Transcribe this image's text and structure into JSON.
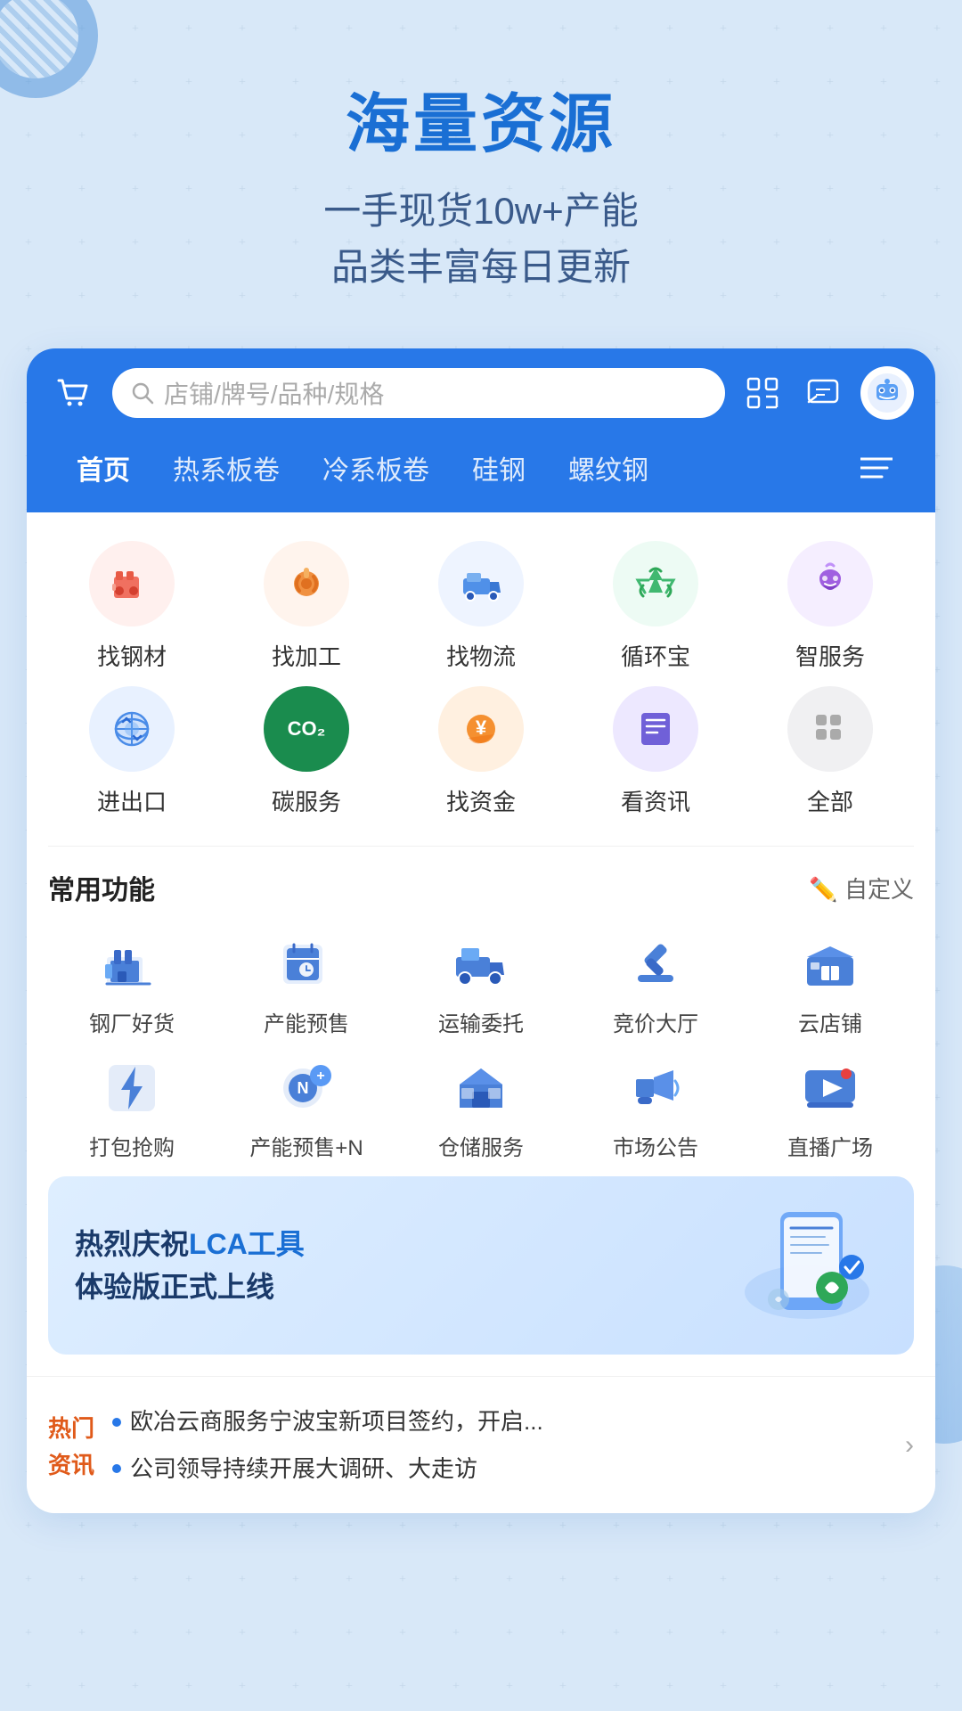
{
  "hero": {
    "title": "海量资源",
    "subtitle_line1": "一手现货10w+产能",
    "subtitle_line2": "品类丰富每日更新"
  },
  "header": {
    "search_placeholder": "店铺/牌号/品种/规格",
    "nav_tabs": [
      {
        "label": "首页",
        "active": true
      },
      {
        "label": "热系板卷",
        "active": false
      },
      {
        "label": "冷系板卷",
        "active": false
      },
      {
        "label": "硅钢",
        "active": false
      },
      {
        "label": "螺纹钢",
        "active": false
      }
    ]
  },
  "icon_categories": [
    {
      "label": "找钢材",
      "color_class": "ic-red",
      "icon": "🏭"
    },
    {
      "label": "找加工",
      "color_class": "ic-orange",
      "icon": "🔧"
    },
    {
      "label": "找物流",
      "color_class": "ic-blue",
      "icon": "🚛"
    },
    {
      "label": "循环宝",
      "color_class": "ic-green",
      "icon": "♻️"
    },
    {
      "label": "智服务",
      "color_class": "ic-purple",
      "icon": "💜"
    },
    {
      "label": "进出口",
      "color_class": "ic-blue2",
      "icon": "🌐"
    },
    {
      "label": "碳服务",
      "color_class": "ic-dkgreen",
      "icon": "CO₂"
    },
    {
      "label": "找资金",
      "color_class": "ic-orange2",
      "icon": "💰"
    },
    {
      "label": "看资讯",
      "color_class": "ic-indigo",
      "icon": "📋"
    },
    {
      "label": "全部",
      "color_class": "ic-gray",
      "icon": "⊞"
    }
  ],
  "common_functions": {
    "section_title": "常用功能",
    "action_label": "✏️ 自定义",
    "items": [
      {
        "label": "钢厂好货",
        "icon": "🏭"
      },
      {
        "label": "产能预售",
        "icon": "⏱"
      },
      {
        "label": "运输委托",
        "icon": "🚛"
      },
      {
        "label": "竞价大厅",
        "icon": "🔨"
      },
      {
        "label": "云店铺",
        "icon": "🏪"
      },
      {
        "label": "打包抢购",
        "icon": "⚡"
      },
      {
        "label": "产能预售+N",
        "icon": "🔵"
      },
      {
        "label": "仓储服务",
        "icon": "🏠"
      },
      {
        "label": "市场公告",
        "icon": "📢"
      },
      {
        "label": "直播广场",
        "icon": "▶️"
      }
    ]
  },
  "banner": {
    "line1": "热烈庆祝LCA工具",
    "line2": "体验版正式上线",
    "highlight_word": "LCA工具"
  },
  "news": {
    "tag_line1": "热门",
    "tag_line2": "资讯",
    "items": [
      "欧冶云商服务宁波宝新项目签约，开启...",
      "公司领导持续开展大调研、大走访"
    ]
  }
}
